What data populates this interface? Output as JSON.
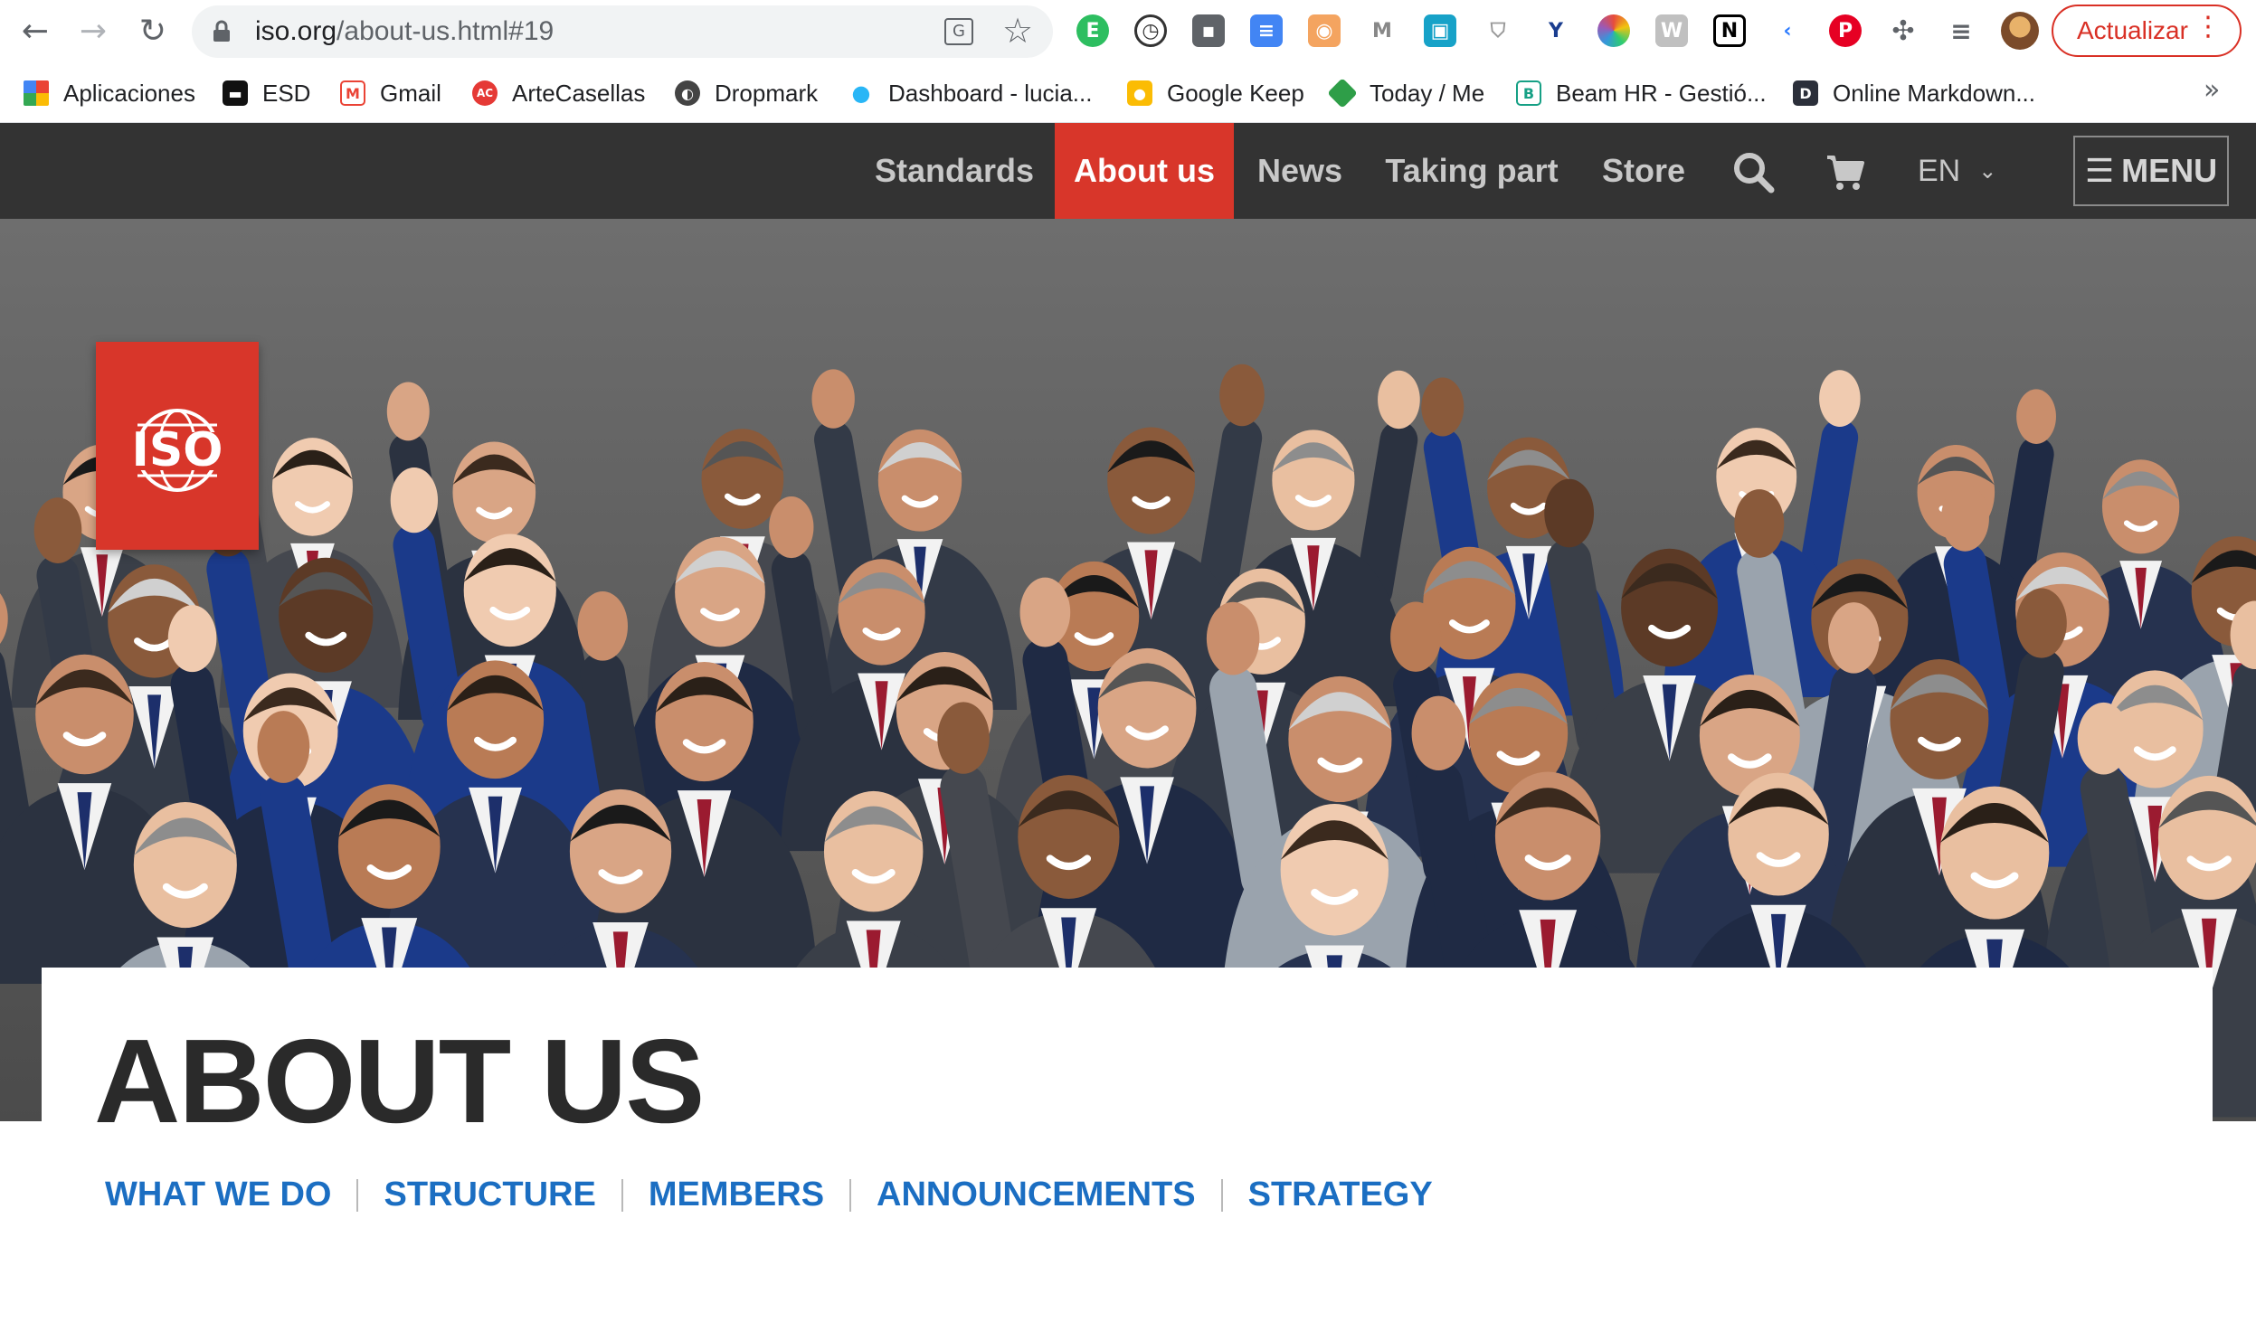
{
  "browser": {
    "url_host": "iso.org",
    "url_path": "/about-us.html#19",
    "update_label": "Actualizar",
    "more_bookmarks": "»",
    "bookmarks": [
      {
        "label": "Aplicaciones"
      },
      {
        "label": "ESD"
      },
      {
        "label": "Gmail"
      },
      {
        "label": "ArteCasellas"
      },
      {
        "label": "Dropmark"
      },
      {
        "label": "Dashboard - lucia..."
      },
      {
        "label": "Google Keep"
      },
      {
        "label": "Today / Me"
      },
      {
        "label": "Beam HR - Gestió..."
      },
      {
        "label": "Online Markdown..."
      }
    ]
  },
  "site": {
    "logo_text": "ISO",
    "nav": [
      {
        "label": "Standards"
      },
      {
        "label": "About us",
        "active": true
      },
      {
        "label": "News"
      },
      {
        "label": "Taking part"
      },
      {
        "label": "Store"
      }
    ],
    "language": "EN",
    "menu_label": "MENU",
    "accent_color": "#d8362a",
    "header_color": "#333333",
    "link_color": "#1b6ec2"
  },
  "page": {
    "title": "ABOUT US",
    "subnav": [
      {
        "label": "WHAT WE DO"
      },
      {
        "label": "STRUCTURE"
      },
      {
        "label": "MEMBERS"
      },
      {
        "label": "ANNOUNCEMENTS"
      },
      {
        "label": "STRATEGY"
      }
    ]
  }
}
